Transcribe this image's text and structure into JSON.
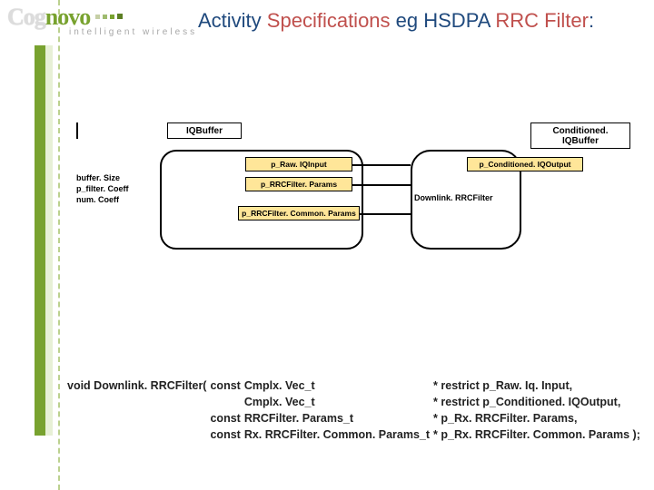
{
  "logo": {
    "part1": "Cog",
    "part2": "novo",
    "tagline": "intelligent wireless"
  },
  "title": {
    "pre": "Activity ",
    "hl1": "Specifications",
    "mid": " eg HSDPA ",
    "hl2": "RRC Filter",
    "post": ":"
  },
  "iq_buffer": "IQBuffer",
  "cond_buffer": "Conditioned. IQBuffer",
  "side": {
    "l1": "buffer. Size",
    "l2": "p_filter. Coeff",
    "l3": "num. Coeff"
  },
  "pin_raw": "p_Raw. IQInput",
  "pin_parm": "p_RRCFilter. Params",
  "pin_comm": "p_RRCFilter. Common. Params",
  "pin_out": "p_Conditioned. IQOutput",
  "dl_label": "Downlink. RRCFilter",
  "sig": {
    "fn": "void Downlink. RRCFilter(",
    "rows": [
      {
        "q": "const",
        "t": "Cmplx. Vec_t",
        "p": "* restrict p_Raw. Iq. Input,"
      },
      {
        "q": "",
        "t": "Cmplx. Vec_t",
        "p": "* restrict p_Conditioned. IQOutput,"
      },
      {
        "q": "const",
        "t": "RRCFilter. Params_t",
        "p": "* p_Rx. RRCFilter. Params,"
      },
      {
        "q": "const",
        "t": "Rx. RRCFilter. Common. Params_t",
        "p": "* p_Rx. RRCFilter. Common. Params );"
      }
    ]
  }
}
